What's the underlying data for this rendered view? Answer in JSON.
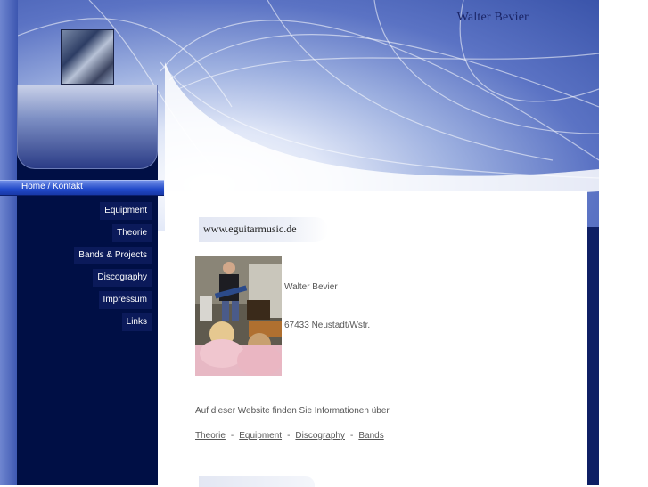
{
  "header": {
    "site_title": "Walter Bevier"
  },
  "nav": {
    "home_label": "Home / Kontakt",
    "items": [
      {
        "label": "Equipment"
      },
      {
        "label": "Theorie"
      },
      {
        "label": "Bands & Projects"
      },
      {
        "label": "Discography"
      },
      {
        "label": "Impressum"
      },
      {
        "label": "Links"
      }
    ]
  },
  "content": {
    "url": "www.eguitarmusic.de",
    "contact_name": "Walter Bevier",
    "contact_city": "67433 Neustadt/Wstr.",
    "intro": "Auf dieser Website finden Sie Informationen über",
    "links": [
      {
        "label": "Theorie"
      },
      {
        "label": "Equipment"
      },
      {
        "label": "Discography"
      },
      {
        "label": "Bands"
      }
    ],
    "link_separator": "-"
  },
  "colors": {
    "nav_background": "#000f45",
    "active_bar": "#2149c8",
    "header_blue": "#5b73c4"
  }
}
